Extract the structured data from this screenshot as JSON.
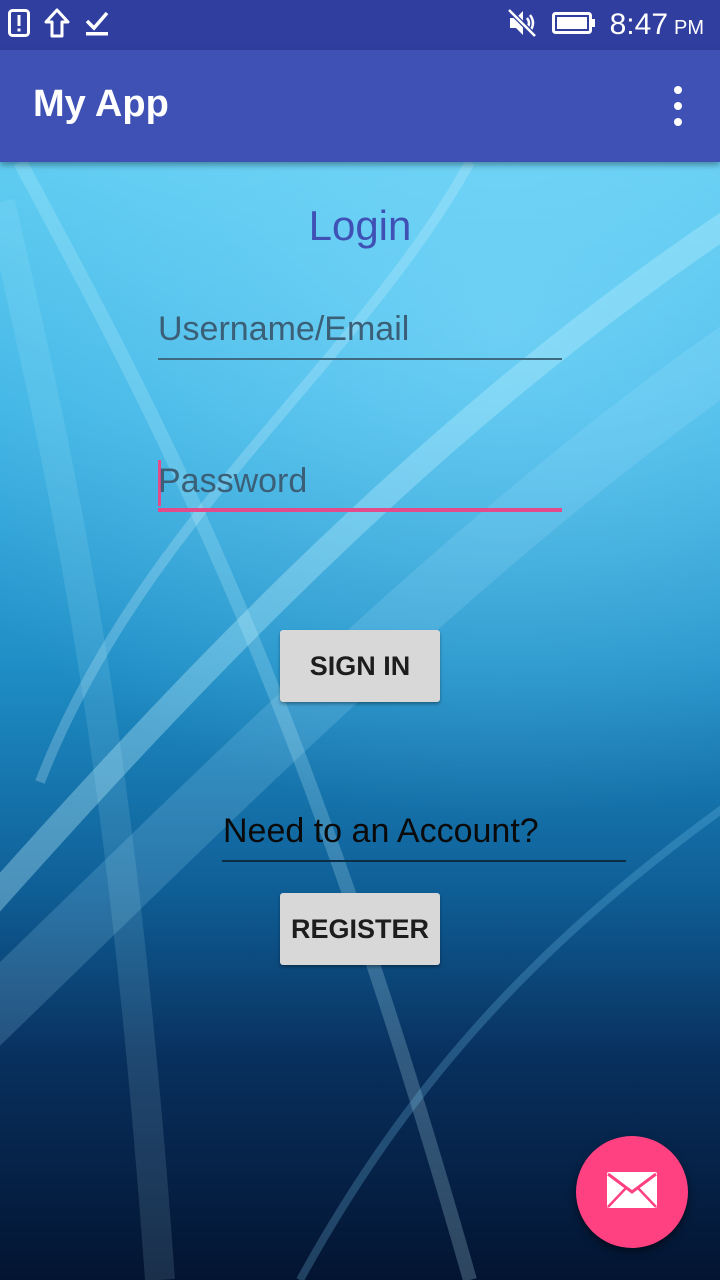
{
  "status_bar": {
    "icons": [
      "alert-icon",
      "upload-icon",
      "download-done-icon",
      "mute-icon",
      "battery-icon"
    ],
    "time": "8:47",
    "ampm": "PM"
  },
  "app_bar": {
    "title": "My App",
    "menu_icon": "more-vert-icon"
  },
  "login": {
    "title": "Login",
    "username_placeholder": "Username/Email",
    "password_placeholder": "Password",
    "signin_label": "SIGN IN",
    "account_text": "Need to an Account?",
    "register_label": "REGISTER"
  },
  "fab": {
    "icon": "mail-icon"
  },
  "colors": {
    "status_bar": "#303f9f",
    "app_bar": "#3f51b5",
    "accent": "#ff4081",
    "button": "#d8d8d8"
  }
}
